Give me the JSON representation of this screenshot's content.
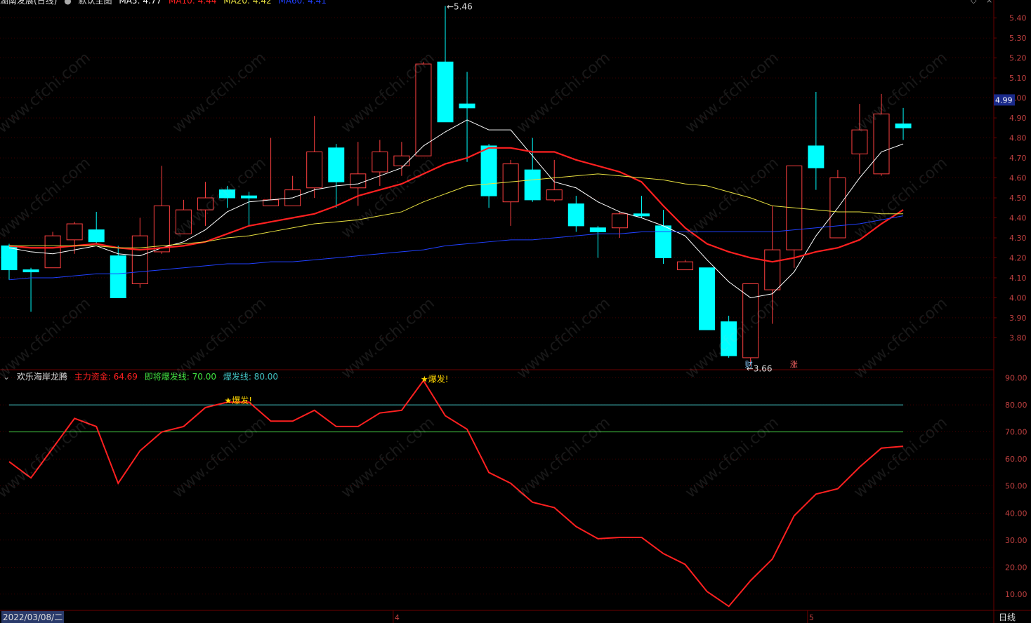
{
  "header": {
    "stock": "湖南发展(日线)",
    "indicator": "默认主图",
    "ma5": "MA5: 4.77",
    "ma10": "MA10: 4.44",
    "ma20": "MA20: 4.42",
    "ma60": "MA60: 4.41"
  },
  "indicator_header": {
    "name": "欢乐海岸龙腾",
    "main_fund": "主力资金: 64.69",
    "near_line": "即将爆发线: 70.00",
    "burst_line": "爆发线: 80.00"
  },
  "status": {
    "date": "2022/03/08/二",
    "period": "日线",
    "price_tag": "4.99"
  },
  "watermark": "www.cfchi.com",
  "markers": {
    "finance": "财",
    "rise": "涨",
    "burst": "★爆发!",
    "hi_label": "5.46",
    "lo_label": "3.66"
  },
  "colors": {
    "up": "#ff4040",
    "down": "#00ffff",
    "ma5": "#ffffff",
    "ma10": "#ff2020",
    "ma20": "#e8e040",
    "ma60": "#2040ff",
    "fund": "#ff2020",
    "line70": "#40c040",
    "line80": "#40c0c0",
    "grid": "#6a0000"
  },
  "chart_data": {
    "type": "candlestick",
    "price_axis": {
      "ticks": [
        "5.40",
        "5.30",
        "5.20",
        "5.10",
        "5.00",
        "4.90",
        "4.80",
        "4.70",
        "4.60",
        "4.50",
        "4.40",
        "4.30",
        "4.20",
        "4.10",
        "4.00",
        "3.90",
        "3.80"
      ],
      "ylim": [
        3.64,
        5.49
      ]
    },
    "x_labels": [
      {
        "label": "4",
        "index": 18
      },
      {
        "label": "5",
        "index": 37
      }
    ],
    "candles": [
      {
        "o": 4.26,
        "c": 4.14,
        "h": 4.27,
        "l": 4.09
      },
      {
        "o": 4.14,
        "c": 4.13,
        "h": 4.15,
        "l": 3.93
      },
      {
        "o": 4.15,
        "c": 4.31,
        "h": 4.33,
        "l": 4.15
      },
      {
        "o": 4.29,
        "c": 4.37,
        "h": 4.38,
        "l": 4.22
      },
      {
        "o": 4.34,
        "c": 4.28,
        "h": 4.43,
        "l": 4.27
      },
      {
        "o": 4.21,
        "c": 4.0,
        "h": 4.26,
        "l": 4.0
      },
      {
        "o": 4.07,
        "c": 4.31,
        "h": 4.4,
        "l": 4.05
      },
      {
        "o": 4.23,
        "c": 4.46,
        "h": 4.66,
        "l": 4.22
      },
      {
        "o": 4.32,
        "c": 4.44,
        "h": 4.49,
        "l": 4.32
      },
      {
        "o": 4.44,
        "c": 4.5,
        "h": 4.58,
        "l": 4.36
      },
      {
        "o": 4.54,
        "c": 4.5,
        "h": 4.56,
        "l": 4.45
      },
      {
        "o": 4.51,
        "c": 4.5,
        "h": 4.53,
        "l": 4.36
      },
      {
        "o": 4.46,
        "c": 4.49,
        "h": 4.8,
        "l": 4.46
      },
      {
        "o": 4.46,
        "c": 4.54,
        "h": 4.61,
        "l": 4.46
      },
      {
        "o": 4.55,
        "c": 4.73,
        "h": 4.91,
        "l": 4.5
      },
      {
        "o": 4.75,
        "c": 4.58,
        "h": 4.77,
        "l": 4.45
      },
      {
        "o": 4.55,
        "c": 4.62,
        "h": 4.78,
        "l": 4.46
      },
      {
        "o": 4.63,
        "c": 4.73,
        "h": 4.79,
        "l": 4.56
      },
      {
        "o": 4.66,
        "c": 4.71,
        "h": 4.78,
        "l": 4.61
      },
      {
        "o": 4.71,
        "c": 5.17,
        "h": 5.18,
        "l": 4.71
      },
      {
        "o": 5.18,
        "c": 4.88,
        "h": 5.46,
        "l": 4.88
      },
      {
        "o": 4.97,
        "c": 4.95,
        "h": 5.13,
        "l": 4.68
      },
      {
        "o": 4.76,
        "c": 4.51,
        "h": 4.77,
        "l": 4.45
      },
      {
        "o": 4.48,
        "c": 4.67,
        "h": 4.69,
        "l": 4.36
      },
      {
        "o": 4.64,
        "c": 4.49,
        "h": 4.8,
        "l": 4.48
      },
      {
        "o": 4.49,
        "c": 4.54,
        "h": 4.69,
        "l": 4.48
      },
      {
        "o": 4.47,
        "c": 4.36,
        "h": 4.51,
        "l": 4.33
      },
      {
        "o": 4.35,
        "c": 4.33,
        "h": 4.36,
        "l": 4.2
      },
      {
        "o": 4.35,
        "c": 4.42,
        "h": 4.43,
        "l": 4.3
      },
      {
        "o": 4.42,
        "c": 4.41,
        "h": 4.51,
        "l": 4.4
      },
      {
        "o": 4.36,
        "c": 4.2,
        "h": 4.44,
        "l": 4.17
      },
      {
        "o": 4.14,
        "c": 4.18,
        "h": 4.19,
        "l": 4.14
      },
      {
        "o": 4.15,
        "c": 3.84,
        "h": 4.15,
        "l": 3.84
      },
      {
        "o": 3.88,
        "c": 3.71,
        "h": 3.91,
        "l": 3.7
      },
      {
        "o": 3.7,
        "c": 4.07,
        "h": 4.07,
        "l": 3.66
      },
      {
        "o": 4.04,
        "c": 4.24,
        "h": 4.46,
        "l": 3.87
      },
      {
        "o": 4.24,
        "c": 4.66,
        "h": 4.66,
        "l": 4.15
      },
      {
        "o": 4.76,
        "c": 4.65,
        "h": 5.03,
        "l": 4.54
      },
      {
        "o": 4.3,
        "c": 4.6,
        "h": 4.64,
        "l": 4.3
      },
      {
        "o": 4.72,
        "c": 4.84,
        "h": 4.97,
        "l": 4.62
      },
      {
        "o": 4.62,
        "c": 4.92,
        "h": 5.02,
        "l": 4.61
      },
      {
        "o": 4.87,
        "c": 4.85,
        "h": 4.95,
        "l": 4.79
      }
    ],
    "ma_series": [
      {
        "name": "MA5",
        "values": [
          4.25,
          4.23,
          4.22,
          4.24,
          4.26,
          4.22,
          4.21,
          4.25,
          4.28,
          4.34,
          4.43,
          4.48,
          4.49,
          4.5,
          4.54,
          4.56,
          4.57,
          4.61,
          4.65,
          4.76,
          4.83,
          4.89,
          4.84,
          4.84,
          4.71,
          4.58,
          4.55,
          4.48,
          4.43,
          4.4,
          4.36,
          4.31,
          4.19,
          4.08,
          4.0,
          4.02,
          4.13,
          4.31,
          4.45,
          4.6,
          4.73,
          4.77
        ]
      },
      {
        "name": "MA10",
        "values": [
          4.26,
          4.25,
          4.25,
          4.26,
          4.27,
          4.25,
          4.24,
          4.25,
          4.26,
          4.28,
          4.32,
          4.36,
          4.38,
          4.4,
          4.42,
          4.46,
          4.51,
          4.54,
          4.57,
          4.62,
          4.67,
          4.7,
          4.75,
          4.75,
          4.73,
          4.73,
          4.69,
          4.66,
          4.63,
          4.58,
          4.46,
          4.35,
          4.27,
          4.23,
          4.2,
          4.18,
          4.2,
          4.23,
          4.25,
          4.29,
          4.37,
          4.44
        ]
      },
      {
        "name": "MA20",
        "values": [
          4.26,
          4.26,
          4.26,
          4.26,
          4.26,
          4.25,
          4.25,
          4.26,
          4.27,
          4.28,
          4.3,
          4.31,
          4.33,
          4.35,
          4.37,
          4.38,
          4.39,
          4.41,
          4.43,
          4.48,
          4.52,
          4.56,
          4.57,
          4.58,
          4.59,
          4.6,
          4.61,
          4.62,
          4.61,
          4.6,
          4.59,
          4.57,
          4.56,
          4.53,
          4.5,
          4.46,
          4.45,
          4.44,
          4.43,
          4.43,
          4.42,
          4.42
        ]
      },
      {
        "name": "MA60",
        "values": [
          4.09,
          4.1,
          4.1,
          4.11,
          4.12,
          4.12,
          4.13,
          4.14,
          4.15,
          4.16,
          4.17,
          4.17,
          4.18,
          4.18,
          4.19,
          4.2,
          4.21,
          4.22,
          4.23,
          4.24,
          4.26,
          4.27,
          4.28,
          4.29,
          4.29,
          4.3,
          4.31,
          4.32,
          4.32,
          4.33,
          4.33,
          4.33,
          4.33,
          4.33,
          4.33,
          4.33,
          4.34,
          4.35,
          4.36,
          4.37,
          4.39,
          4.41
        ]
      }
    ],
    "indicator": {
      "axis_ticks": [
        "90.00",
        "80.00",
        "70.00",
        "60.00",
        "50.00",
        "40.00",
        "30.00",
        "20.00",
        "10.00"
      ],
      "ylim": [
        4,
        93
      ],
      "main_fund": [
        59,
        53,
        64,
        75,
        72,
        51,
        63,
        70,
        72,
        79,
        81,
        81,
        74,
        74,
        78,
        72,
        72,
        77,
        78,
        89,
        76,
        71,
        55,
        51,
        44,
        42,
        35,
        30.5,
        31,
        31,
        25,
        21,
        11,
        5.5,
        15,
        23,
        39,
        47,
        49,
        57,
        64,
        64.7
      ],
      "lines": [
        70,
        80
      ],
      "burst_points": [
        10,
        19
      ]
    }
  }
}
